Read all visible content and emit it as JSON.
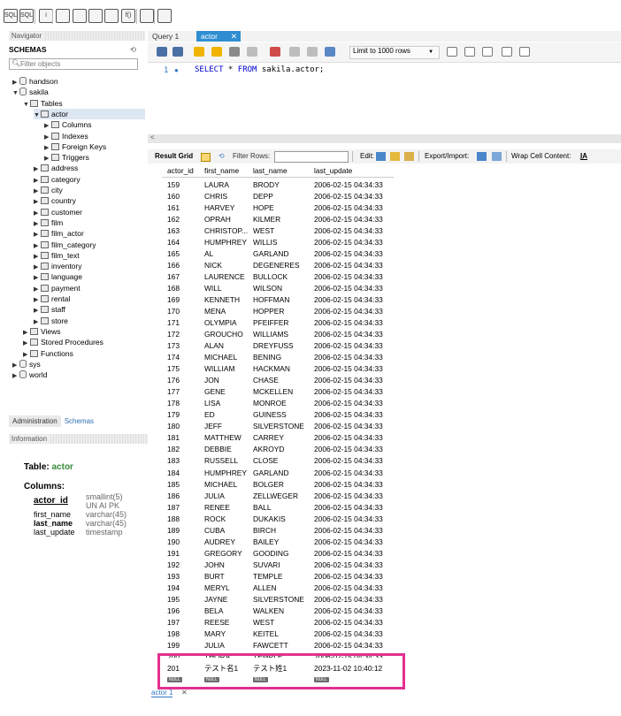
{
  "toolbar": {
    "icons": [
      "new-sql-tab-icon",
      "open-sql-file-icon",
      "info-icon",
      "create-schema-icon",
      "create-table-icon",
      "create-view-icon",
      "create-procedure-icon",
      "create-function-icon",
      "search-table-icon",
      "reconnect-icon"
    ],
    "labels": [
      "SQL",
      "SQL",
      "i",
      "",
      "",
      "",
      "",
      "f()",
      "",
      ""
    ]
  },
  "navigator": {
    "title": "Navigator",
    "schemas_label": "SCHEMAS",
    "filter_placeholder": "Filter objects",
    "tree": [
      {
        "label": "handson",
        "level": 0,
        "arrow": "▶",
        "icon": "db"
      },
      {
        "label": "sakila",
        "level": 0,
        "arrow": "▼",
        "icon": "db"
      },
      {
        "label": "Tables",
        "level": 1,
        "arrow": "▼",
        "icon": "folder"
      },
      {
        "label": "actor",
        "level": 2,
        "arrow": "▼",
        "icon": "table",
        "selected": true
      },
      {
        "label": "Columns",
        "level": 3,
        "arrow": "▶",
        "icon": "folder"
      },
      {
        "label": "Indexes",
        "level": 3,
        "arrow": "▶",
        "icon": "folder"
      },
      {
        "label": "Foreign Keys",
        "level": 3,
        "arrow": "▶",
        "icon": "folder"
      },
      {
        "label": "Triggers",
        "level": 3,
        "arrow": "▶",
        "icon": "folder"
      },
      {
        "label": "address",
        "level": 2,
        "arrow": "▶",
        "icon": "table"
      },
      {
        "label": "category",
        "level": 2,
        "arrow": "▶",
        "icon": "table"
      },
      {
        "label": "city",
        "level": 2,
        "arrow": "▶",
        "icon": "table"
      },
      {
        "label": "country",
        "level": 2,
        "arrow": "▶",
        "icon": "table"
      },
      {
        "label": "customer",
        "level": 2,
        "arrow": "▶",
        "icon": "table"
      },
      {
        "label": "film",
        "level": 2,
        "arrow": "▶",
        "icon": "table"
      },
      {
        "label": "film_actor",
        "level": 2,
        "arrow": "▶",
        "icon": "table"
      },
      {
        "label": "film_category",
        "level": 2,
        "arrow": "▶",
        "icon": "table"
      },
      {
        "label": "film_text",
        "level": 2,
        "arrow": "▶",
        "icon": "table"
      },
      {
        "label": "inventory",
        "level": 2,
        "arrow": "▶",
        "icon": "table"
      },
      {
        "label": "language",
        "level": 2,
        "arrow": "▶",
        "icon": "table"
      },
      {
        "label": "payment",
        "level": 2,
        "arrow": "▶",
        "icon": "table"
      },
      {
        "label": "rental",
        "level": 2,
        "arrow": "▶",
        "icon": "table"
      },
      {
        "label": "staff",
        "level": 2,
        "arrow": "▶",
        "icon": "table"
      },
      {
        "label": "store",
        "level": 2,
        "arrow": "▶",
        "icon": "table"
      },
      {
        "label": "Views",
        "level": 1,
        "arrow": "▶",
        "icon": "folder"
      },
      {
        "label": "Stored Procedures",
        "level": 1,
        "arrow": "▶",
        "icon": "folder"
      },
      {
        "label": "Functions",
        "level": 1,
        "arrow": "▶",
        "icon": "folder"
      },
      {
        "label": "sys",
        "level": 0,
        "arrow": "▶",
        "icon": "db"
      },
      {
        "label": "world",
        "level": 0,
        "arrow": "▶",
        "icon": "db"
      }
    ]
  },
  "bottom_left": {
    "tabs": [
      "Administration",
      "Schemas"
    ],
    "info_title": "Information",
    "table_label": "Table:",
    "table_name": "actor",
    "columns_label": "Columns:",
    "columns": [
      {
        "name": "actor_id",
        "type": "smallint(5)",
        "extra": "UN AI PK"
      },
      {
        "name": "first_name",
        "type": "varchar(45)"
      },
      {
        "name": "last_name",
        "type": "varchar(45)"
      },
      {
        "name": "last_update",
        "type": "timestamp"
      }
    ]
  },
  "query_tabs": [
    "Query 1",
    "actor"
  ],
  "editor": {
    "limit_label": "Limit to 1000 rows",
    "line_number": "1",
    "sql_keyword1": "SELECT",
    "sql_rest1": " * ",
    "sql_keyword2": "FROM",
    "sql_rest2": " sakila.actor;"
  },
  "result_toolbar": {
    "result_grid": "Result Grid",
    "filter_rows": "Filter Rows:",
    "edit": "Edit:",
    "export_import": "Export/Import:",
    "wrap_cell": "Wrap Cell Content:"
  },
  "grid": {
    "columns": [
      "actor_id",
      "first_name",
      "last_name",
      "last_update"
    ],
    "rows": [
      [
        "159",
        "LAURA",
        "BRODY",
        "2006-02-15 04:34:33"
      ],
      [
        "160",
        "CHRIS",
        "DEPP",
        "2006-02-15 04:34:33"
      ],
      [
        "161",
        "HARVEY",
        "HOPE",
        "2006-02-15 04:34:33"
      ],
      [
        "162",
        "OPRAH",
        "KILMER",
        "2006-02-15 04:34:33"
      ],
      [
        "163",
        "CHRISTOP...",
        "WEST",
        "2006-02-15 04:34:33"
      ],
      [
        "164",
        "HUMPHREY",
        "WILLIS",
        "2006-02-15 04:34:33"
      ],
      [
        "165",
        "AL",
        "GARLAND",
        "2006-02-15 04:34:33"
      ],
      [
        "166",
        "NICK",
        "DEGENERES",
        "2006-02-15 04:34:33"
      ],
      [
        "167",
        "LAURENCE",
        "BULLOCK",
        "2006-02-15 04:34:33"
      ],
      [
        "168",
        "WILL",
        "WILSON",
        "2006-02-15 04:34:33"
      ],
      [
        "169",
        "KENNETH",
        "HOFFMAN",
        "2006-02-15 04:34:33"
      ],
      [
        "170",
        "MENA",
        "HOPPER",
        "2006-02-15 04:34:33"
      ],
      [
        "171",
        "OLYMPIA",
        "PFEIFFER",
        "2006-02-15 04:34:33"
      ],
      [
        "172",
        "GROUCHO",
        "WILLIAMS",
        "2006-02-15 04:34:33"
      ],
      [
        "173",
        "ALAN",
        "DREYFUSS",
        "2006-02-15 04:34:33"
      ],
      [
        "174",
        "MICHAEL",
        "BENING",
        "2006-02-15 04:34:33"
      ],
      [
        "175",
        "WILLIAM",
        "HACKMAN",
        "2006-02-15 04:34:33"
      ],
      [
        "176",
        "JON",
        "CHASE",
        "2006-02-15 04:34:33"
      ],
      [
        "177",
        "GENE",
        "MCKELLEN",
        "2006-02-15 04:34:33"
      ],
      [
        "178",
        "LISA",
        "MONROE",
        "2006-02-15 04:34:33"
      ],
      [
        "179",
        "ED",
        "GUINESS",
        "2006-02-15 04:34:33"
      ],
      [
        "180",
        "JEFF",
        "SILVERSTONE",
        "2006-02-15 04:34:33"
      ],
      [
        "181",
        "MATTHEW",
        "CARREY",
        "2006-02-15 04:34:33"
      ],
      [
        "182",
        "DEBBIE",
        "AKROYD",
        "2006-02-15 04:34:33"
      ],
      [
        "183",
        "RUSSELL",
        "CLOSE",
        "2006-02-15 04:34:33"
      ],
      [
        "184",
        "HUMPHREY",
        "GARLAND",
        "2006-02-15 04:34:33"
      ],
      [
        "185",
        "MICHAEL",
        "BOLGER",
        "2006-02-15 04:34:33"
      ],
      [
        "186",
        "JULIA",
        "ZELLWEGER",
        "2006-02-15 04:34:33"
      ],
      [
        "187",
        "RENEE",
        "BALL",
        "2006-02-15 04:34:33"
      ],
      [
        "188",
        "ROCK",
        "DUKAKIS",
        "2006-02-15 04:34:33"
      ],
      [
        "189",
        "CUBA",
        "BIRCH",
        "2006-02-15 04:34:33"
      ],
      [
        "190",
        "AUDREY",
        "BAILEY",
        "2006-02-15 04:34:33"
      ],
      [
        "191",
        "GREGORY",
        "GOODING",
        "2006-02-15 04:34:33"
      ],
      [
        "192",
        "JOHN",
        "SUVARI",
        "2006-02-15 04:34:33"
      ],
      [
        "193",
        "BURT",
        "TEMPLE",
        "2006-02-15 04:34:33"
      ],
      [
        "194",
        "MERYL",
        "ALLEN",
        "2006-02-15 04:34:33"
      ],
      [
        "195",
        "JAYNE",
        "SILVERSTONE",
        "2006-02-15 04:34:33"
      ],
      [
        "196",
        "BELA",
        "WALKEN",
        "2006-02-15 04:34:33"
      ],
      [
        "197",
        "REESE",
        "WEST",
        "2006-02-15 04:34:33"
      ],
      [
        "198",
        "MARY",
        "KEITEL",
        "2006-02-15 04:34:33"
      ],
      [
        "199",
        "JULIA",
        "FAWCETT",
        "2006-02-15 04:34:33"
      ],
      [
        "200",
        "THORA",
        "TEMPLE",
        "2006-02-15 04:34:33"
      ],
      [
        "201",
        "テスト名1",
        "テスト姓1",
        "2023-11-02 10:40:12"
      ]
    ],
    "null_label": "NULL"
  },
  "bottom_tab": "actor 1",
  "colors": {
    "highlight": "#e4308f",
    "accent": "#2f8ed1",
    "keyword": "#0000cc"
  }
}
